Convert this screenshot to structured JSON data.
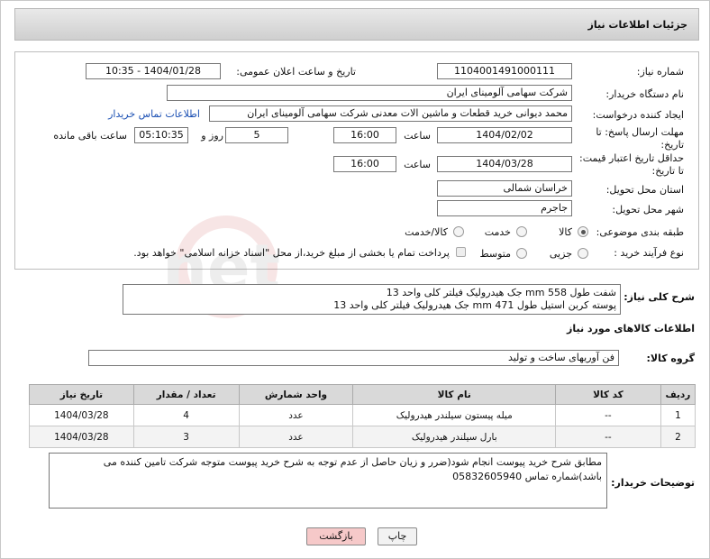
{
  "header": {
    "title": "جزئیات اطلاعات نیاز"
  },
  "form": {
    "need_number_label": "شماره نیاز:",
    "need_number": "1104001491000111",
    "announce_label": "تاریخ و ساعت اعلان عمومی:",
    "announce_value": "1404/01/28 - 10:35",
    "buyer_org_label": "نام دستگاه خریدار:",
    "buyer_org": "شرکت سهامی آلومینای ایران",
    "creator_label": "ایجاد کننده درخواست:",
    "creator": "محمد دیوانی خرید قطعات و ماشین الات معدنی شرکت سهامی آلومینای ایران",
    "contact_link": "اطلاعات تماس خریدار",
    "deadline_label1": "مهلت ارسال پاسخ: تا",
    "deadline_label2": "تاریخ:",
    "deadline_date": "1404/02/02",
    "time_label": "ساعت",
    "deadline_time": "16:00",
    "days": "5",
    "days_label": "روز و",
    "remaining_time": "05:10:35",
    "remaining_label": "ساعت باقی مانده",
    "validity_label1": "حداقل تاریخ اعتبار قیمت:",
    "validity_label2": "تا تاریخ:",
    "validity_date": "1404/03/28",
    "validity_time": "16:00",
    "province_label": "استان محل تحویل:",
    "province": "خراسان شمالی",
    "city_label": "شهر محل تحویل:",
    "city": "جاجرم",
    "category_label": "طبقه بندی موضوعی:",
    "category_options": [
      "کالا",
      "خدمت",
      "کالا/خدمت"
    ],
    "process_label": "نوع فرآیند خرید :",
    "process_options": [
      "جزیی",
      "متوسط"
    ],
    "payment_note": "پرداخت تمام یا بخشی از مبلغ خرید،از محل \"اسناد خزانه اسلامی\" خواهد بود."
  },
  "description": {
    "label": "شرح کلی نیاز:",
    "line1": "شفت طول 558 mm جک هیدرولیک  فیلتر کلی واحد 13",
    "line2": "پوسته کربن استیل طول 471 mm جک هیدرولیک  فیلتر کلی واحد 13"
  },
  "goods": {
    "section_title": "اطلاعات کالاهای مورد نیاز",
    "group_label": "گروه کالا:",
    "group_value": "فن آوریهای ساخت و تولید",
    "columns": [
      "ردیف",
      "کد کالا",
      "نام کالا",
      "واحد شمارش",
      "تعداد / مقدار",
      "تاریخ نیاز"
    ],
    "rows": [
      {
        "idx": "1",
        "code": "--",
        "name": "میله پیستون سیلندر هیدرولیک",
        "unit": "عدد",
        "qty": "4",
        "date": "1404/03/28"
      },
      {
        "idx": "2",
        "code": "--",
        "name": "بارل سیلندر هیدرولیک",
        "unit": "عدد",
        "qty": "3",
        "date": "1404/03/28"
      }
    ]
  },
  "notes": {
    "label": "توضیحات خریدار:",
    "text": "مطابق شرح خرید پیوست انجام شود(ضرر و زیان حاصل از عدم توجه به شرح خرید پیوست متوجه شرکت تامین کننده می باشد)شماره تماس 05832605940"
  },
  "buttons": {
    "print": "چاپ",
    "back": "بازگشت"
  },
  "watermark": "AriaTender.net",
  "colors": {
    "link": "#1a4fb3",
    "back_btn_bg": "#f6c9c9",
    "header_bg": "#d6d6d6"
  }
}
